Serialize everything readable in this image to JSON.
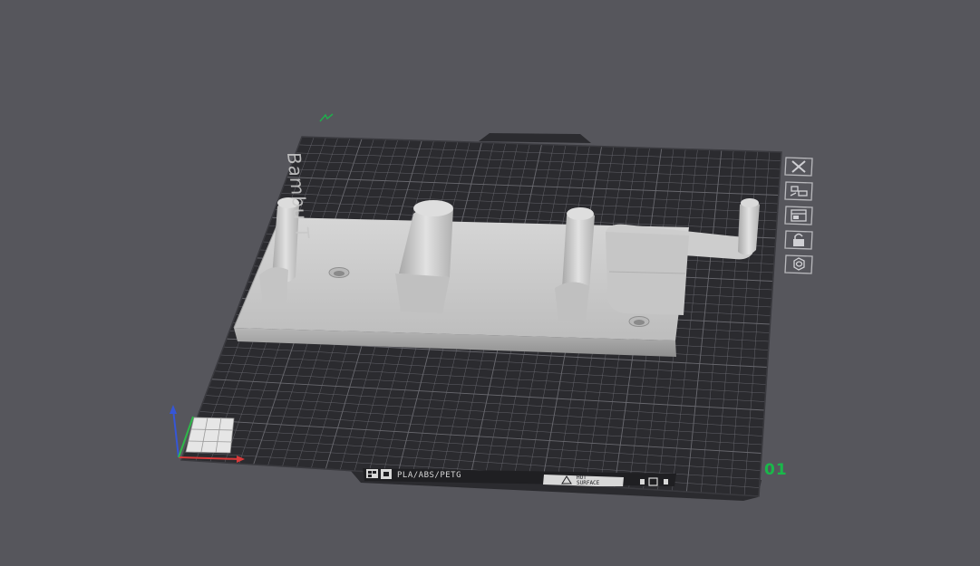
{
  "viewport": {
    "background": "#56565c",
    "bed_color": "#2b2b2f",
    "grid_color": "#6a6a70",
    "model_color": "#c9c9c9"
  },
  "bed": {
    "brand_text": "Bambu T",
    "material_label": "PLA/ABS/PETG",
    "warning_line1": "HOT",
    "warning_line2": "SURFACE",
    "warning_icon": "warning-triangle-icon"
  },
  "plate": {
    "number": "01",
    "small_label": "01"
  },
  "toolbar": {
    "buttons": [
      {
        "name": "delete-plate-button",
        "icon": "close-icon"
      },
      {
        "name": "arrange-plate-button",
        "icon": "arrange-icon"
      },
      {
        "name": "orient-plate-button",
        "icon": "layout-icon"
      },
      {
        "name": "lock-plate-button",
        "icon": "lock-icon"
      },
      {
        "name": "plate-settings-button",
        "icon": "settings-icon"
      }
    ]
  },
  "axes": {
    "x_color": "#d83a3a",
    "y_color": "#2fb84a",
    "z_color": "#3656d6"
  }
}
